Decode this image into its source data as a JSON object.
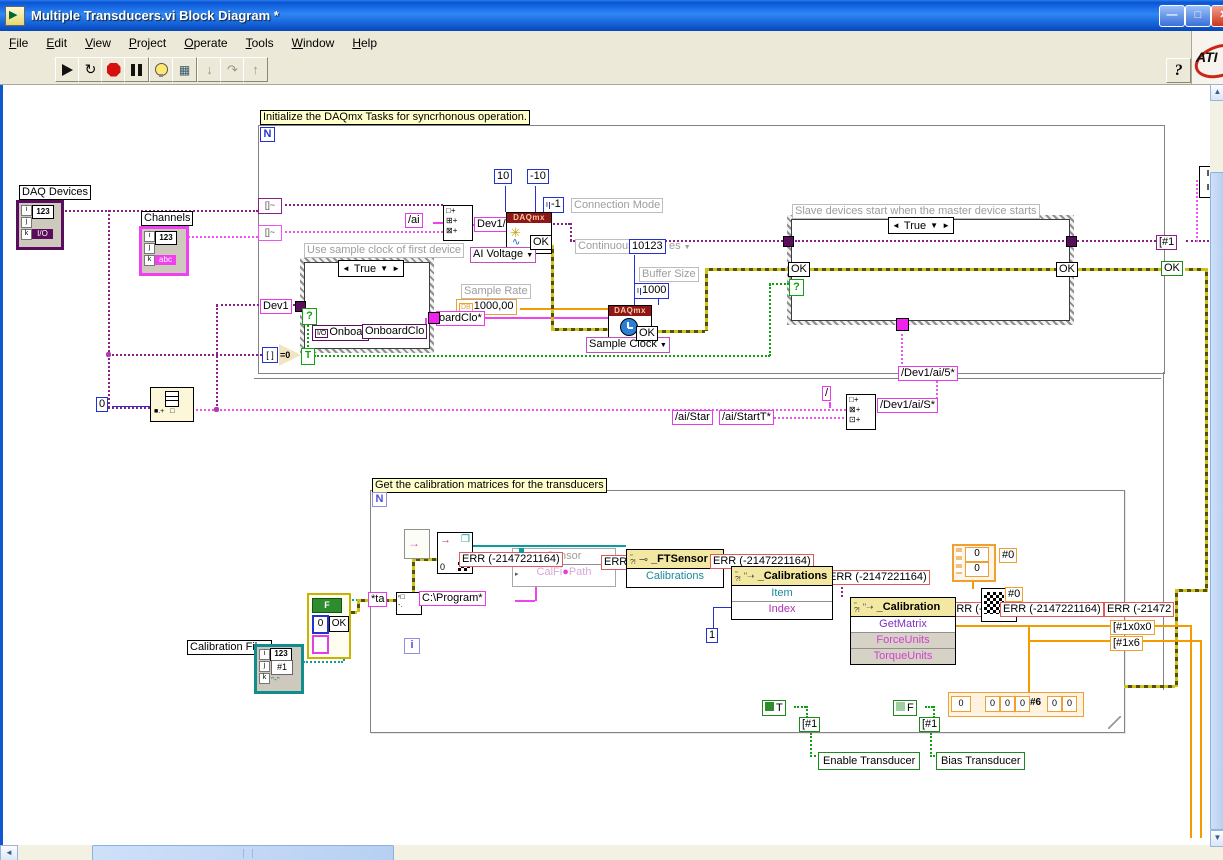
{
  "window": {
    "title": "Multiple Transducers.vi Block Diagram *"
  },
  "menu": {
    "items": [
      "File",
      "Edit",
      "View",
      "Project",
      "Operate",
      "Tools",
      "Window",
      "Help"
    ]
  },
  "toolbar": {
    "help": "?"
  },
  "logo": {
    "text": "ATI"
  },
  "icons": {
    "dropdown": "▼",
    "left": "◄",
    "right": "►",
    "up": "▲",
    "down": "▼",
    "back": "◄",
    "minimize": "—",
    "maximize": "□",
    "close": "✕"
  },
  "colors": {
    "label_yellow": "#ffffcc",
    "daqmx_red": "#8e1616",
    "error_red_border": "#e05a5a",
    "string_pink": "#ee44ee",
    "task_purple": "#8a1f8a",
    "bool_green": "#12a112",
    "numeric_blue": "#2431d2",
    "dbl_orange": "#f49b00",
    "path_teal": "#0f9b9b",
    "titlebar_blue": "#0a55d5"
  },
  "diagram": {
    "init_comment": "Initialize the DAQmx Tasks for syncrhonous operation.",
    "cal_comment": "Get the calibration matrices for the transducers",
    "slave_label": "Slave devices start when the master device starts",
    "use_clock_label": "Use sample clock of first device",
    "daq_devices_label": "DAQ Devices",
    "channels_label": "Channels",
    "calibration_files_label": "Calibration Files",
    "icon_io": "I/O",
    "icon_abc": "abc",
    "icon_123": "123",
    "icon_i": "i",
    "icon_j": "j",
    "icon_k": "k",
    "icon_hash1": "#1",
    "n": "N",
    "i": "i",
    "q": "?",
    "ok": "OK",
    "dev1": "Dev1",
    "true_label": "True",
    "onboard_a": "Onboar",
    "onboard_b": "OnboardClo",
    "oardclo": "oardClo*",
    "eq0": "=0",
    "t": "T",
    "f": "F",
    "zero": "0",
    "one": "1",
    "ten": "10",
    "minus10": "-10",
    "minus1": "-1",
    "sample_rate_label": "Sample Rate",
    "sample_rate_value": "1000,00",
    "buffer_size_label": "Buffer Size",
    "buffer_value": "1000",
    "connection_mode": "Connection Mode",
    "continuous": "Continuous",
    "cont_value": "10123",
    "cont_suffix": "es",
    "daqmx": "DAQmx",
    "ai_voltage": "AI Voltage",
    "sample_clock": "Sample Clock",
    "slash_ai": "/ai",
    "dev1_ai0": "Dev1/ai0",
    "hash1": "[#1",
    "dev1_ai5_top": "/Dev1/ai/5*",
    "slash": "/",
    "dev1_ai5": "/Dev1/ai/S*",
    "ai_star": "/ai/Star",
    "ai_startt": "/ai/StartT*",
    "err_full": "ERR (-2147221164)",
    "err_short": "ERR",
    "err_cut_a": "ERR (-2",
    "err_cut_b": "ERR (-21472",
    "sensor": "Sensor",
    "calfi": "CalFi",
    "path": "Path",
    "ftsensor": "_FTSensor",
    "calibrations": "Calibrations",
    "calibrations_node": "_Calibrations",
    "item": "Item",
    "index": "Index",
    "calibration_node": "_Calibration",
    "getmatrix": "GetMatrix",
    "forceunits": "ForceUnits",
    "torqueunits": "TorqueUnits",
    "hash0": "#0",
    "hash6": "#6",
    "arr_1x0x0": "[#1x0x0",
    "arr_1x6": "[#1x6",
    "ta": "*ta",
    "c_program": "C:\\Program*",
    "enable": "Enable Transducer",
    "bias": "Bias Transducer"
  }
}
